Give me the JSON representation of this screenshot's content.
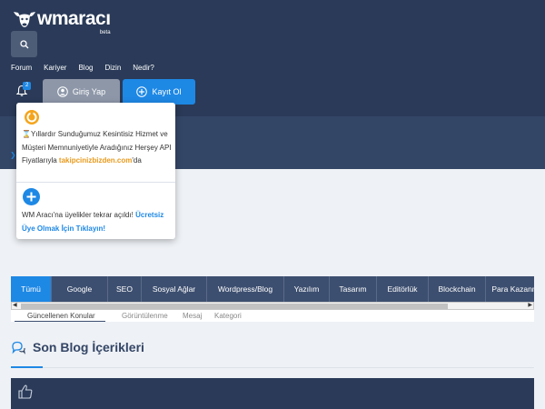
{
  "header": {
    "logo_text": "wmaracı",
    "logo_badge": "beta",
    "nav": [
      "Forum",
      "Kariyer",
      "Blog",
      "Dizin",
      "Nedir?"
    ],
    "notification_count": "2",
    "login_label": "Giriş Yap",
    "register_label": "Kayıt Ol"
  },
  "dropdown": {
    "promo_text": "⌛Yıllardır Sunduğumuz Kesintisiz Hizmet ve Müşteri Memnuniyetiyle Aradığınız Herşey API Fiyatlarıyla ",
    "promo_link": "takipcinizbizden.com",
    "promo_suffix": "'da",
    "signup_text": "WM Aracı'na üyelikler tekrar açıldı! ",
    "signup_link": "Ücretsiz Üye Olmak İçin Tıklayın!"
  },
  "tabs": [
    {
      "label": "Tümü",
      "active": true
    },
    {
      "label": "Google"
    },
    {
      "label": "SEO"
    },
    {
      "label": "Sosyal Ağlar"
    },
    {
      "label": "Wordpress/Blog"
    },
    {
      "label": "Yazılım"
    },
    {
      "label": "Tasarım"
    },
    {
      "label": "Editörlük"
    },
    {
      "label": "Blockchain"
    },
    {
      "label": "Para Kazanma"
    }
  ],
  "sort": {
    "updated": "Güncellenen Konular",
    "views": "Görüntülenme",
    "messages": "Mesaj",
    "category": "Kategori"
  },
  "blog": {
    "title": "Son Blog İçerikleri"
  },
  "colors": {
    "header_bg": "#2a3a58",
    "accent": "#1e88e5",
    "promo_link": "#e89a1a"
  }
}
